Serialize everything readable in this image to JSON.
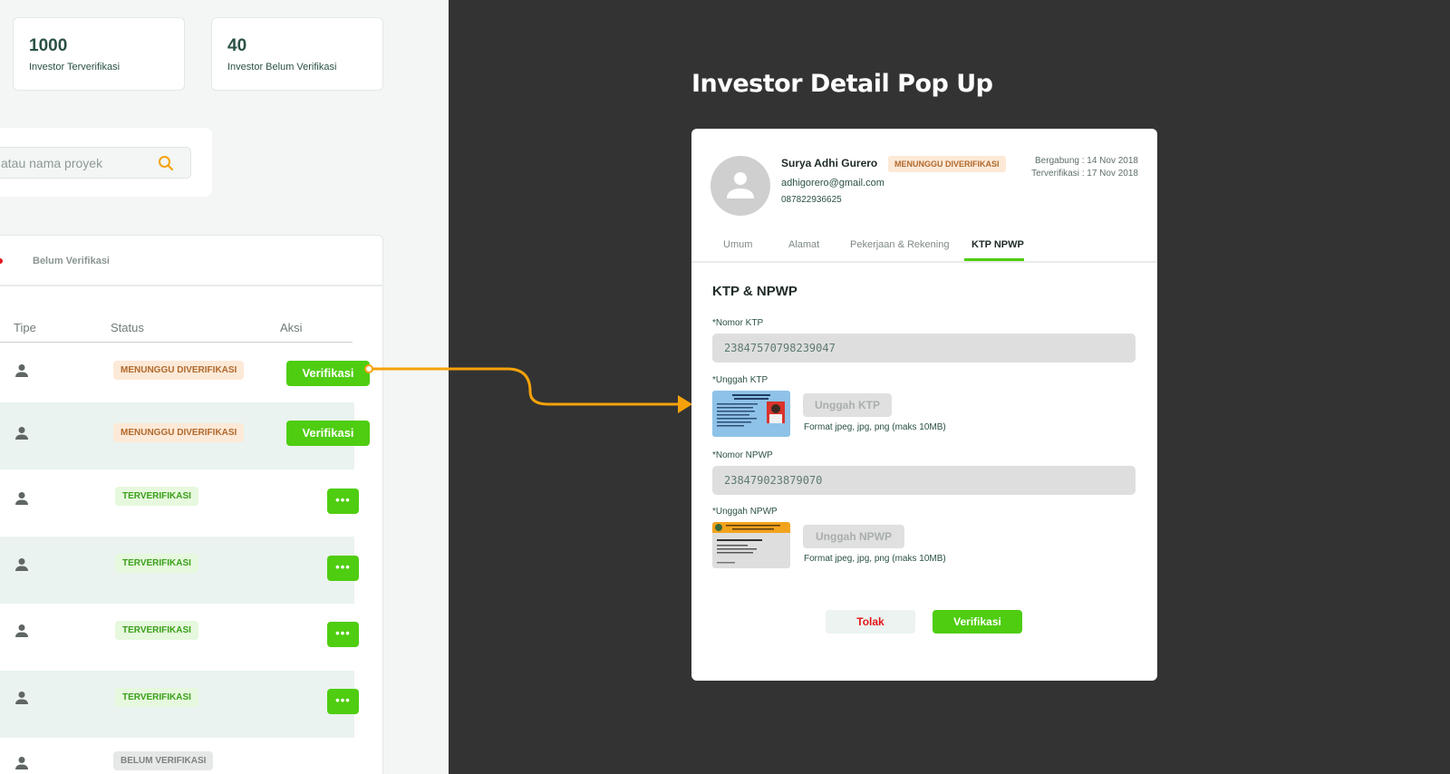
{
  "stats": [
    {
      "value": "1000",
      "label": "Investor Terverifikasi"
    },
    {
      "value": "40",
      "label": "Investor Belum Verifikasi"
    }
  ],
  "search": {
    "placeholder_visible": "atau nama proyek"
  },
  "table": {
    "tab_label": "Belum Verifikasi",
    "headers": {
      "tipe": "Tipe",
      "status": "Status",
      "aksi": "Aksi"
    },
    "rows": [
      {
        "status": "MENUNGGU DIVERIFIKASI",
        "action": "Verifikasi"
      },
      {
        "status": "MENUNGGU DIVERIFIKASI",
        "action": "Verifikasi"
      },
      {
        "status": "TERVERIFIKASI",
        "action": "•••"
      },
      {
        "status": "TERVERIFIKASI",
        "action": "•••"
      },
      {
        "status": "TERVERIFIKASI",
        "action": "•••"
      },
      {
        "status": "TERVERIFIKASI",
        "action": "•••"
      },
      {
        "status": "BELUM VERIFIKASI",
        "action": ""
      }
    ]
  },
  "popup": {
    "heading": "Investor Detail Pop Up",
    "name": "Surya Adhi Gurero",
    "status": "MENUNGGU DIVERIFIKASI",
    "email": "adhigorero@gmail.com",
    "phone": "087822936625",
    "joined": "Bergabung : 14 Nov 2018",
    "verified": "Terverifikasi : 17 Nov 2018",
    "tabs": [
      "Umum",
      "Alamat",
      "Pekerjaan & Rekening",
      "KTP NPWP"
    ],
    "section_title": "KTP & NPWP",
    "ktp_label": "*Nomor KTP",
    "ktp_value": "23847570798239047",
    "upload_ktp_label": "*Unggah KTP",
    "upload_ktp_button": "Unggah KTP",
    "format_note": "Format jpeg, jpg, png (maks 10MB)",
    "npwp_label": "*Nomor NPWP",
    "npwp_value": "238479023879070",
    "upload_npwp_label": "*Unggah NPWP",
    "upload_npwp_button": "Unggah NPWP",
    "reject_button": "Tolak",
    "verify_button": "Verifikasi"
  },
  "colors": {
    "accent": "#4fcd11",
    "danger": "#e3161b",
    "arrow": "#f5a20a",
    "dark_bg": "#333333"
  }
}
